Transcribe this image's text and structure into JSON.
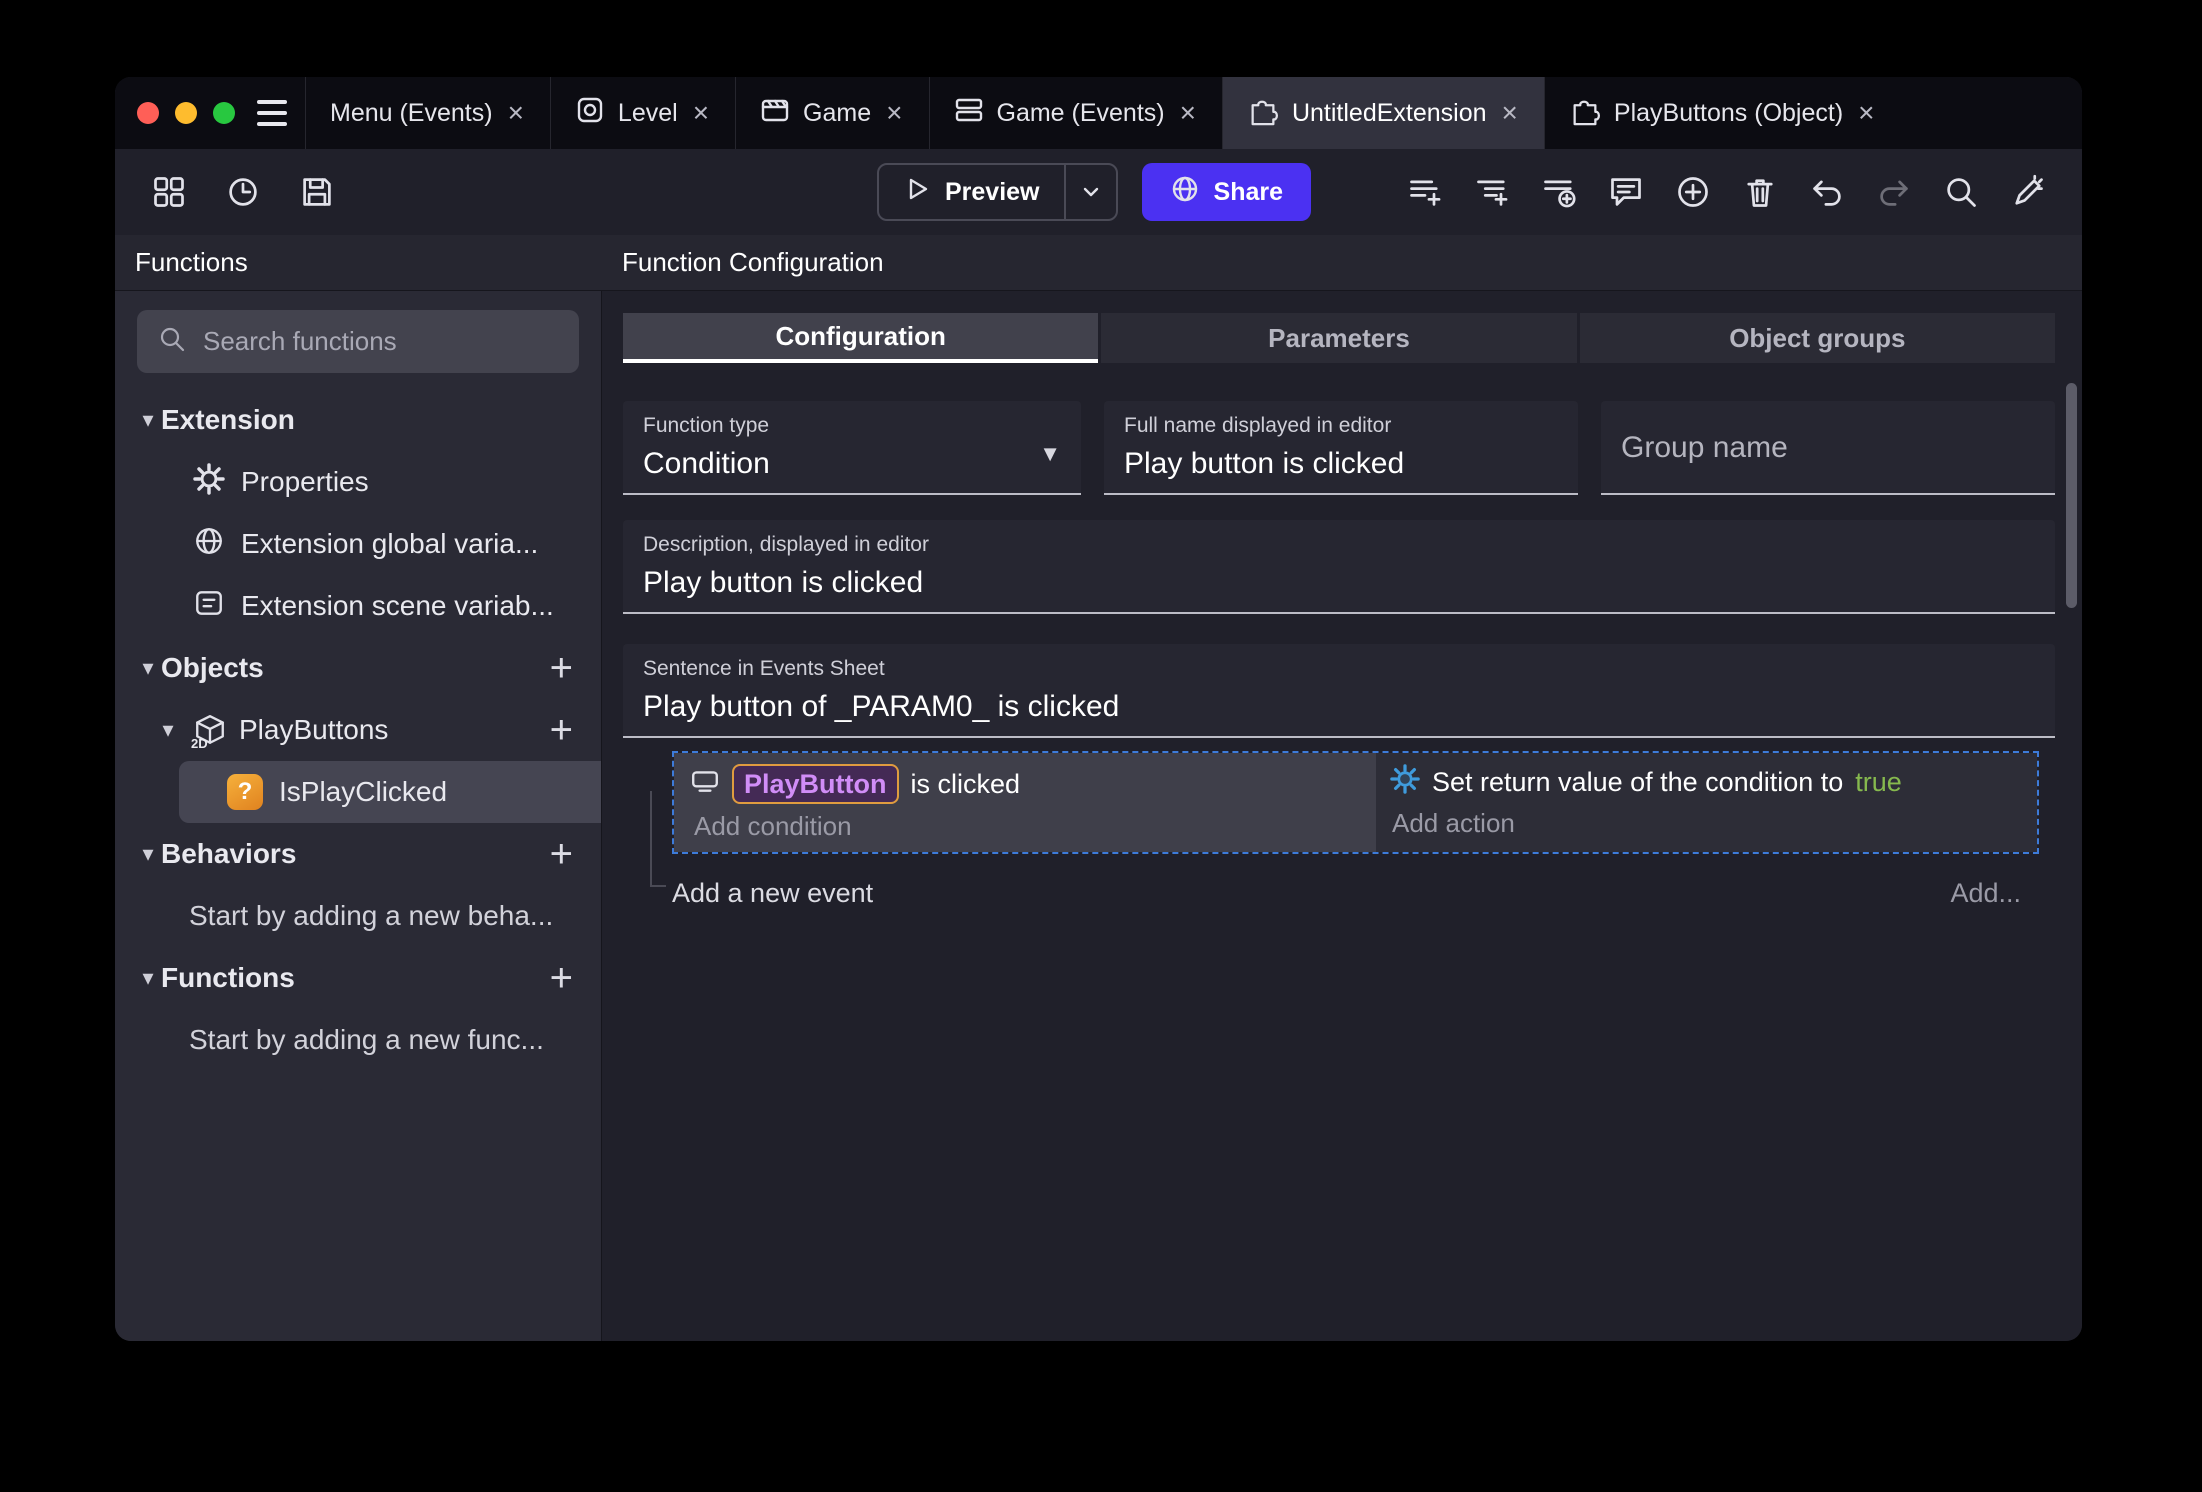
{
  "glyphs": {
    "close": "×",
    "plus": "+",
    "chevron_down": "▾",
    "dropdown": "▼"
  },
  "window_tabs": {
    "items": [
      {
        "label": "Menu (Events)"
      },
      {
        "label": "Level"
      },
      {
        "label": "Game"
      },
      {
        "label": "Game (Events)"
      },
      {
        "label": "UntitledExtension"
      },
      {
        "label": "PlayButtons (Object)"
      }
    ]
  },
  "toolbar": {
    "preview": "Preview",
    "share": "Share"
  },
  "sidebar": {
    "header": "Functions",
    "search_placeholder": "Search functions",
    "extension_section": "Extension",
    "properties": "Properties",
    "global_vars": "Extension global varia...",
    "scene_vars": "Extension scene variab...",
    "objects_section": "Objects",
    "playbuttons": "PlayButtons",
    "isplayclicked": "IsPlayClicked",
    "behaviors_section": "Behaviors",
    "behaviors_hint": "Start by adding a new beha...",
    "functions_section": "Functions",
    "functions_hint": "Start by adding a new func..."
  },
  "main": {
    "header": "Function Configuration",
    "tabs": {
      "configuration": "Configuration",
      "parameters": "Parameters",
      "object_groups": "Object groups"
    },
    "function_type": {
      "label": "Function type",
      "value": "Condition"
    },
    "full_name": {
      "label": "Full name displayed in editor",
      "value": "Play button is clicked"
    },
    "group_name": {
      "placeholder": "Group name"
    },
    "description": {
      "label": "Description, displayed in editor",
      "value": "Play button is clicked"
    },
    "sentence": {
      "label": "Sentence in Events Sheet",
      "value": "Play button of _PARAM0_ is clicked"
    },
    "events": {
      "condition_object": "PlayButton",
      "condition_text": "is clicked",
      "add_condition": "Add condition",
      "action_text": "Set return value of the condition to",
      "action_value": "true",
      "add_action": "Add action",
      "add_new_event": "Add a new event",
      "add_more": "Add..."
    }
  },
  "colors": {
    "accent_purple": "#4b31f2",
    "true_green": "#86b94e",
    "object_name_purple": "#d18df7",
    "object_chip_border": "#e09c3f",
    "selection_dashed_blue": "#3d7bd9"
  }
}
